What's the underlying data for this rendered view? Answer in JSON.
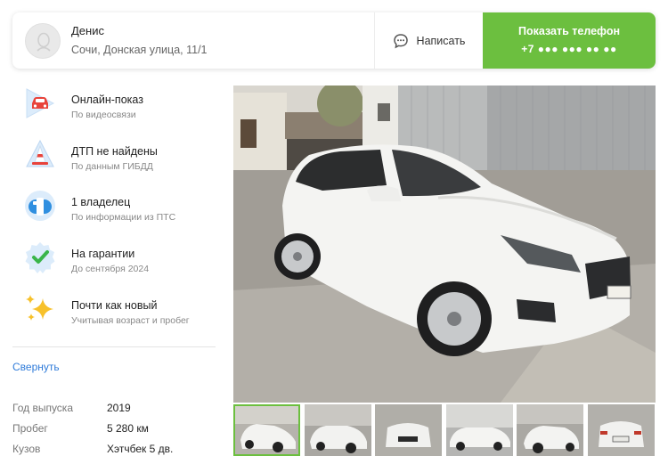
{
  "seller": {
    "name": "Денис",
    "address": "Сочи, Донская улица, 11/1",
    "write_label": "Написать",
    "show_phone_label": "Показать телефон",
    "phone_masked": "+7 ●●● ●●● ●● ●●"
  },
  "features": [
    {
      "title": "Онлайн-показ",
      "subtitle": "По видеосвязи",
      "icon": "video-car-icon"
    },
    {
      "title": "ДТП не найдены",
      "subtitle": "По данным ГИБДД",
      "icon": "traffic-cone-icon"
    },
    {
      "title": "1 владелец",
      "subtitle": "По информации из ПТС",
      "icon": "owner-icon"
    },
    {
      "title": "На гарантии",
      "subtitle": "До сентября 2024",
      "icon": "warranty-badge-icon"
    },
    {
      "title": "Почти как новый",
      "subtitle": "Учитывая возраст и пробег",
      "icon": "sparkles-icon"
    }
  ],
  "collapse_label": "Свернуть",
  "specs": [
    {
      "label": "Год выпуска",
      "value": "2019"
    },
    {
      "label": "Пробег",
      "value": "5 280 км"
    },
    {
      "label": "Кузов",
      "value": "Хэтчбек 5 дв."
    }
  ],
  "gallery": {
    "thumb_count": 6,
    "active_index": 0
  },
  "colors": {
    "accent_green": "#6cbf3f",
    "link_blue": "#2f7bd9"
  }
}
